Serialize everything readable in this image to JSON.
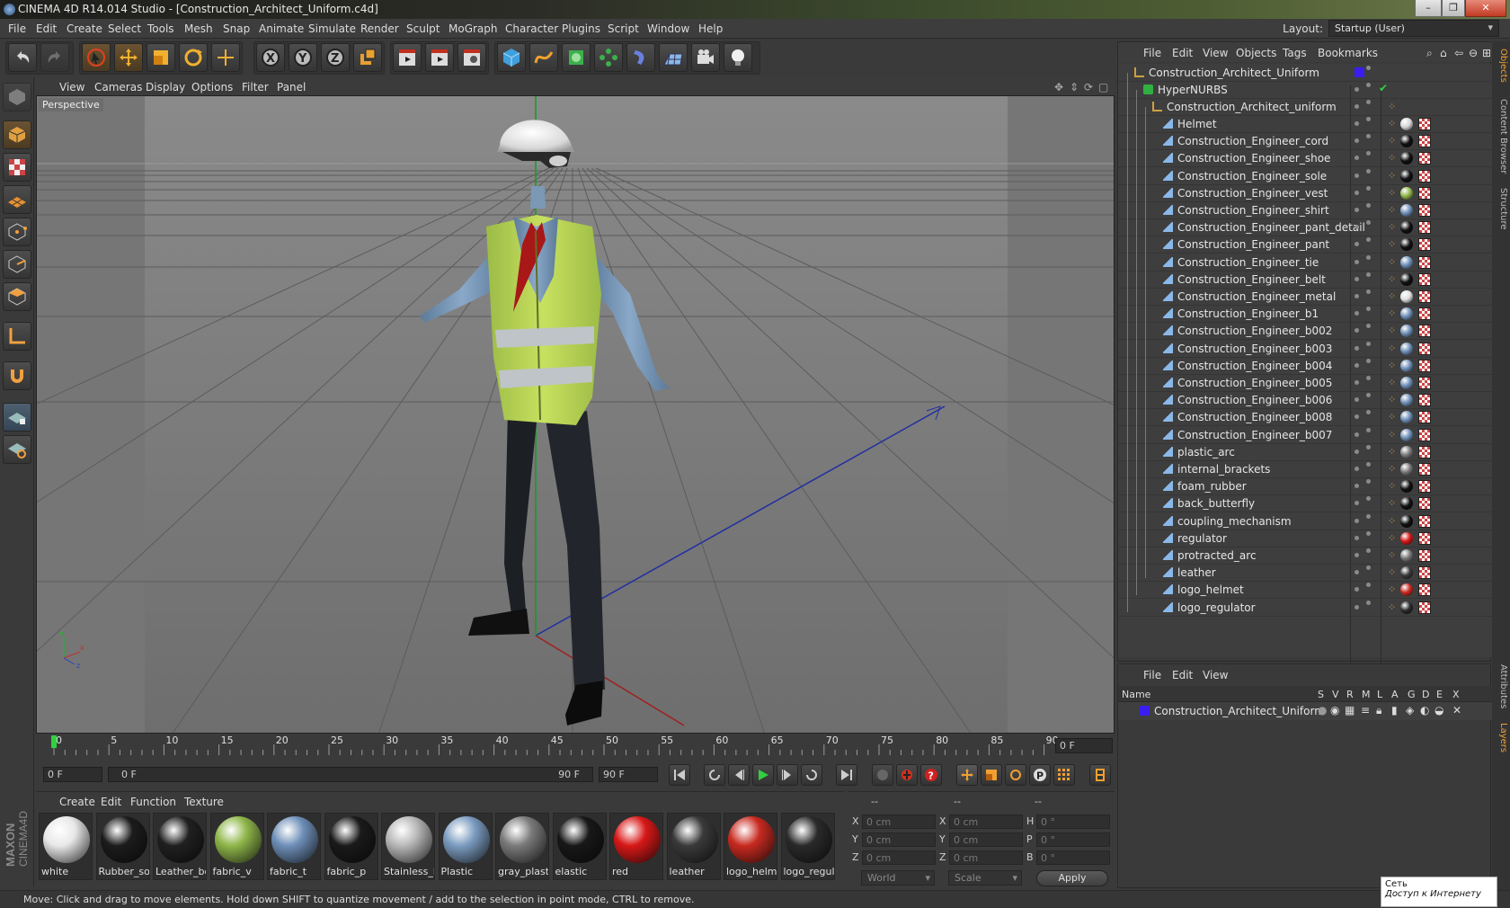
{
  "window": {
    "title": "CINEMA 4D R14.014 Studio - [Construction_Architect_Uniform.c4d]"
  },
  "menubar": [
    "File",
    "Edit",
    "Create",
    "Select",
    "Tools",
    "Mesh",
    "Snap",
    "Animate",
    "Simulate",
    "Render",
    "Sculpt",
    "MoGraph",
    "Character",
    "Plugins",
    "Script",
    "Window",
    "Help"
  ],
  "layout": {
    "label": "Layout:",
    "value": "Startup (User)"
  },
  "viewport": {
    "menu": [
      "View",
      "Cameras",
      "Display",
      "Options",
      "Filter",
      "Panel"
    ],
    "label": "Perspective"
  },
  "timeline": {
    "ticks": [
      "0",
      "5",
      "10",
      "15",
      "20",
      "25",
      "30",
      "35",
      "40",
      "45",
      "50",
      "55",
      "60",
      "65",
      "70",
      "75",
      "80",
      "85",
      "90"
    ],
    "current_frame": "0 F",
    "start_field": "0 F",
    "range_start": "0 F",
    "range_end": "90 F",
    "end_field": "90 F"
  },
  "materials": {
    "menu": [
      "Create",
      "Edit",
      "Function",
      "Texture"
    ],
    "items": [
      {
        "label": "white",
        "color": "#e8e8e8"
      },
      {
        "label": "Rubber_so",
        "color": "#1c1c1c"
      },
      {
        "label": "Leather_bo",
        "color": "#202020"
      },
      {
        "label": "fabric_v",
        "color": "#8fb64a"
      },
      {
        "label": "fabric_t",
        "color": "#6e8fb8"
      },
      {
        "label": "fabric_p",
        "color": "#1a1a1a"
      },
      {
        "label": "Stainless_h",
        "color": "#b8b8b8"
      },
      {
        "label": "Plastic",
        "color": "#7b9cc0"
      },
      {
        "label": "gray_plasti",
        "color": "#7a7a7a"
      },
      {
        "label": "elastic",
        "color": "#181818"
      },
      {
        "label": "red",
        "color": "#d81818"
      },
      {
        "label": "leather",
        "color": "#3a3a3a"
      },
      {
        "label": "logo_helme",
        "color": "#c82a20"
      },
      {
        "label": "logo_regul",
        "color": "#2a2a2a"
      }
    ]
  },
  "coordinates": {
    "headers": [
      "--",
      "--",
      "--"
    ],
    "rows": [
      {
        "a": "X",
        "av": "0 cm",
        "b": "X",
        "bv": "0 cm",
        "c": "H",
        "cv": "0 °"
      },
      {
        "a": "Y",
        "av": "0 cm",
        "b": "Y",
        "bv": "0 cm",
        "c": "P",
        "cv": "0 °"
      },
      {
        "a": "Z",
        "av": "0 cm",
        "b": "Z",
        "bv": "0 cm",
        "c": "B",
        "cv": "0 °"
      }
    ],
    "mode1": "World",
    "mode2": "Scale",
    "apply": "Apply"
  },
  "objects": {
    "menu": [
      "File",
      "Edit",
      "View",
      "Objects",
      "Tags",
      "Bookmarks"
    ],
    "root": "Construction_Architect_Uniform",
    "hypernurbs": "HyperNURBS",
    "group": "Construction_Architect_uniform",
    "items": [
      {
        "name": "Helmet",
        "tag": "#d8d8d8"
      },
      {
        "name": "Construction_Engineer_cord",
        "tag": "#111111"
      },
      {
        "name": "Construction_Engineer_shoe",
        "tag": "#111111"
      },
      {
        "name": "Construction_Engineer_sole",
        "tag": "#111111"
      },
      {
        "name": "Construction_Engineer_vest",
        "tag": "#8fb64a"
      },
      {
        "name": "Construction_Engineer_shirt",
        "tag": "#6e8fb8"
      },
      {
        "name": "Construction_Engineer_pant_detail",
        "tag": "#111111"
      },
      {
        "name": "Construction_Engineer_pant",
        "tag": "#111111"
      },
      {
        "name": "Construction_Engineer_tie",
        "tag": "#6e8fb8"
      },
      {
        "name": "Construction_Engineer_belt",
        "tag": "#111111"
      },
      {
        "name": "Construction_Engineer_metal",
        "tag": "#e0e0e0"
      },
      {
        "name": "Construction_Engineer_b1",
        "tag": "#6e8fb8"
      },
      {
        "name": "Construction_Engineer_b002",
        "tag": "#6e8fb8"
      },
      {
        "name": "Construction_Engineer_b003",
        "tag": "#6e8fb8"
      },
      {
        "name": "Construction_Engineer_b004",
        "tag": "#6e8fb8"
      },
      {
        "name": "Construction_Engineer_b005",
        "tag": "#6e8fb8"
      },
      {
        "name": "Construction_Engineer_b006",
        "tag": "#6e8fb8"
      },
      {
        "name": "Construction_Engineer_b008",
        "tag": "#6e8fb8"
      },
      {
        "name": "Construction_Engineer_b007",
        "tag": "#6e8fb8"
      },
      {
        "name": "plastic_arc",
        "tag": "#7a7a7a"
      },
      {
        "name": "internal_brackets",
        "tag": "#7a7a7a"
      },
      {
        "name": "foam_rubber",
        "tag": "#111111"
      },
      {
        "name": "back_butterfly",
        "tag": "#111111"
      },
      {
        "name": "coupling_mechanism",
        "tag": "#111111"
      },
      {
        "name": "regulator",
        "tag": "#d81818"
      },
      {
        "name": "protracted_arc",
        "tag": "#7a7a7a"
      },
      {
        "name": "leather",
        "tag": "#3a3a3a"
      },
      {
        "name": "logo_helmet",
        "tag": "#c82a20"
      },
      {
        "name": "logo_regulator",
        "tag": "#2a2a2a"
      }
    ]
  },
  "vtabs": [
    "Objects",
    "Content Browser",
    "Structure",
    "Attributes",
    "Layers"
  ],
  "layers": {
    "menu": [
      "File",
      "Edit",
      "View"
    ],
    "headers": [
      "Name",
      "S",
      "V",
      "R",
      "M",
      "L",
      "A",
      "G",
      "D",
      "E",
      "X"
    ],
    "row": "Construction_Architect_Uniform"
  },
  "status": "Move: Click and drag to move elements. Hold down SHIFT to quantize movement / add to the selection in point mode, CTRL to remove.",
  "os_notice": {
    "line1": "Сеть",
    "line2": "Доступ к Интернету"
  },
  "brand": "MAXON CINEMA 4D"
}
